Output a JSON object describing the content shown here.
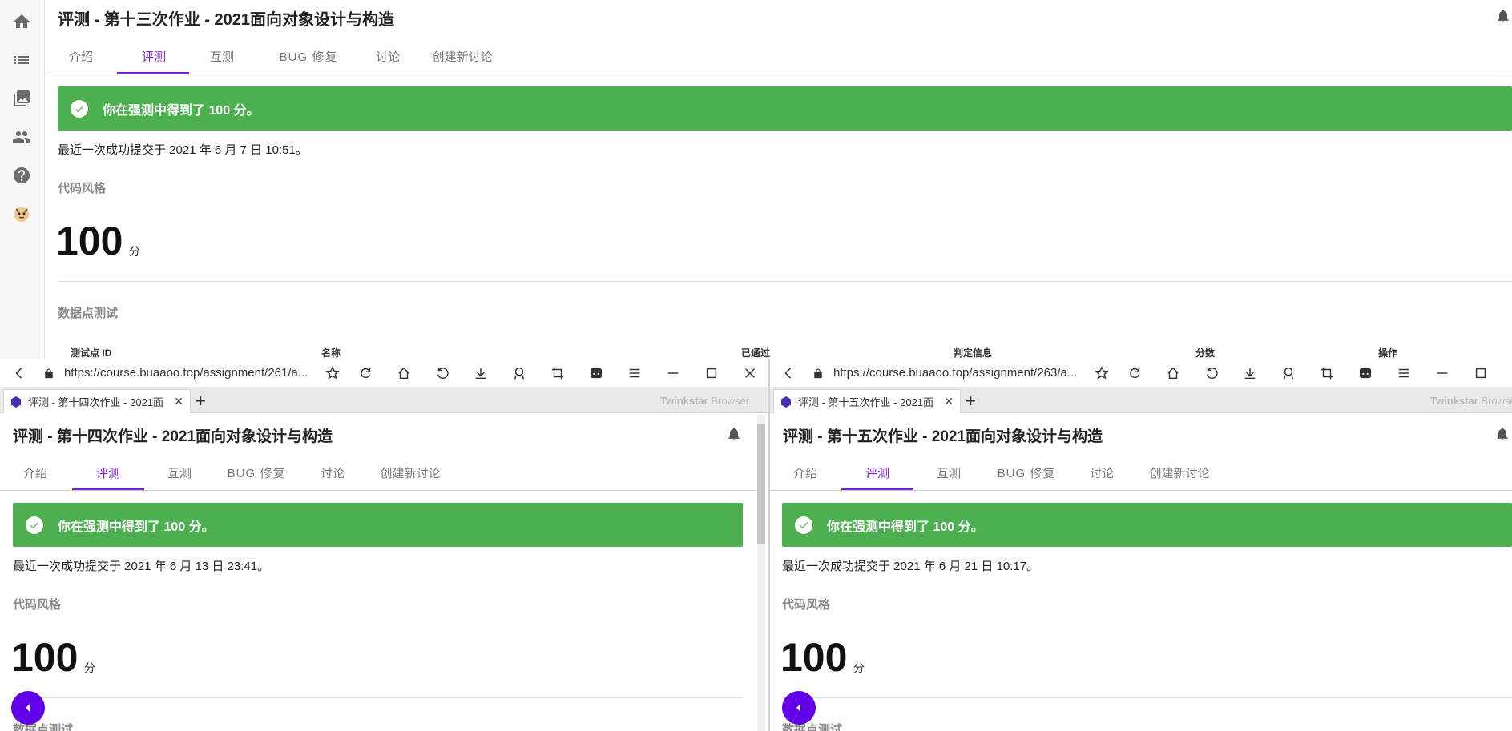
{
  "top": {
    "title": "评测 - 第十三次作业 - 2021面向对象设计与构造",
    "tabs": [
      "介绍",
      "评测",
      "互测",
      "BUG 修复",
      "讨论",
      "创建新讨论"
    ],
    "banner": "你在强测中得到了 100 分。",
    "submitted": "最近一次成功提交于 2021 年 6 月 7 日 10:51。",
    "code_style_title": "代码风格",
    "score": "100",
    "score_unit": "分",
    "data_test_title": "数据点测试",
    "table_headers": [
      "测试点 ID",
      "名称",
      "已通过",
      "判定信息",
      "分数",
      "操作"
    ]
  },
  "sidebar": {
    "icons": [
      "home-icon",
      "list-icon",
      "photo-library-icon",
      "people-icon",
      "help-icon",
      "avatar"
    ]
  },
  "left_pane": {
    "url": "https://course.buaaoo.top/assignment/261/a...",
    "tab_title": "评测 - 第十四次作业 - 2021面",
    "brand": "Twinkstar",
    "brand_suffix": "Browser",
    "title": "评测 - 第十四次作业 - 2021面向对象设计与构造",
    "tabs": [
      "介绍",
      "评测",
      "互测",
      "BUG 修复",
      "讨论",
      "创建新讨论"
    ],
    "banner": "你在强测中得到了 100 分。",
    "submitted": "最近一次成功提交于 2021 年 6 月 13 日 23:41。",
    "code_style_title": "代码风格",
    "score": "100",
    "score_unit": "分",
    "data_test_title": "数据点测试"
  },
  "right_pane": {
    "url": "https://course.buaaoo.top/assignment/263/a...",
    "tab_title": "评测 - 第十五次作业 - 2021面",
    "brand": "Twinkstar",
    "brand_suffix": "Browser",
    "title": "评测 - 第十五次作业 - 2021面向对象设计与构造",
    "tabs": [
      "介绍",
      "评测",
      "互测",
      "BUG 修复",
      "讨论",
      "创建新讨论"
    ],
    "banner": "你在强测中得到了 100 分。",
    "submitted": "最近一次成功提交于 2021 年 6 月 21 日 10:17。",
    "code_style_title": "代码风格",
    "score": "100",
    "score_unit": "分",
    "data_test_title": "数据点测试"
  },
  "colors": {
    "accent": "#7b1fd6",
    "success": "#4caf50",
    "fab": "#6200ea",
    "favicon": "#4b2bb5"
  }
}
